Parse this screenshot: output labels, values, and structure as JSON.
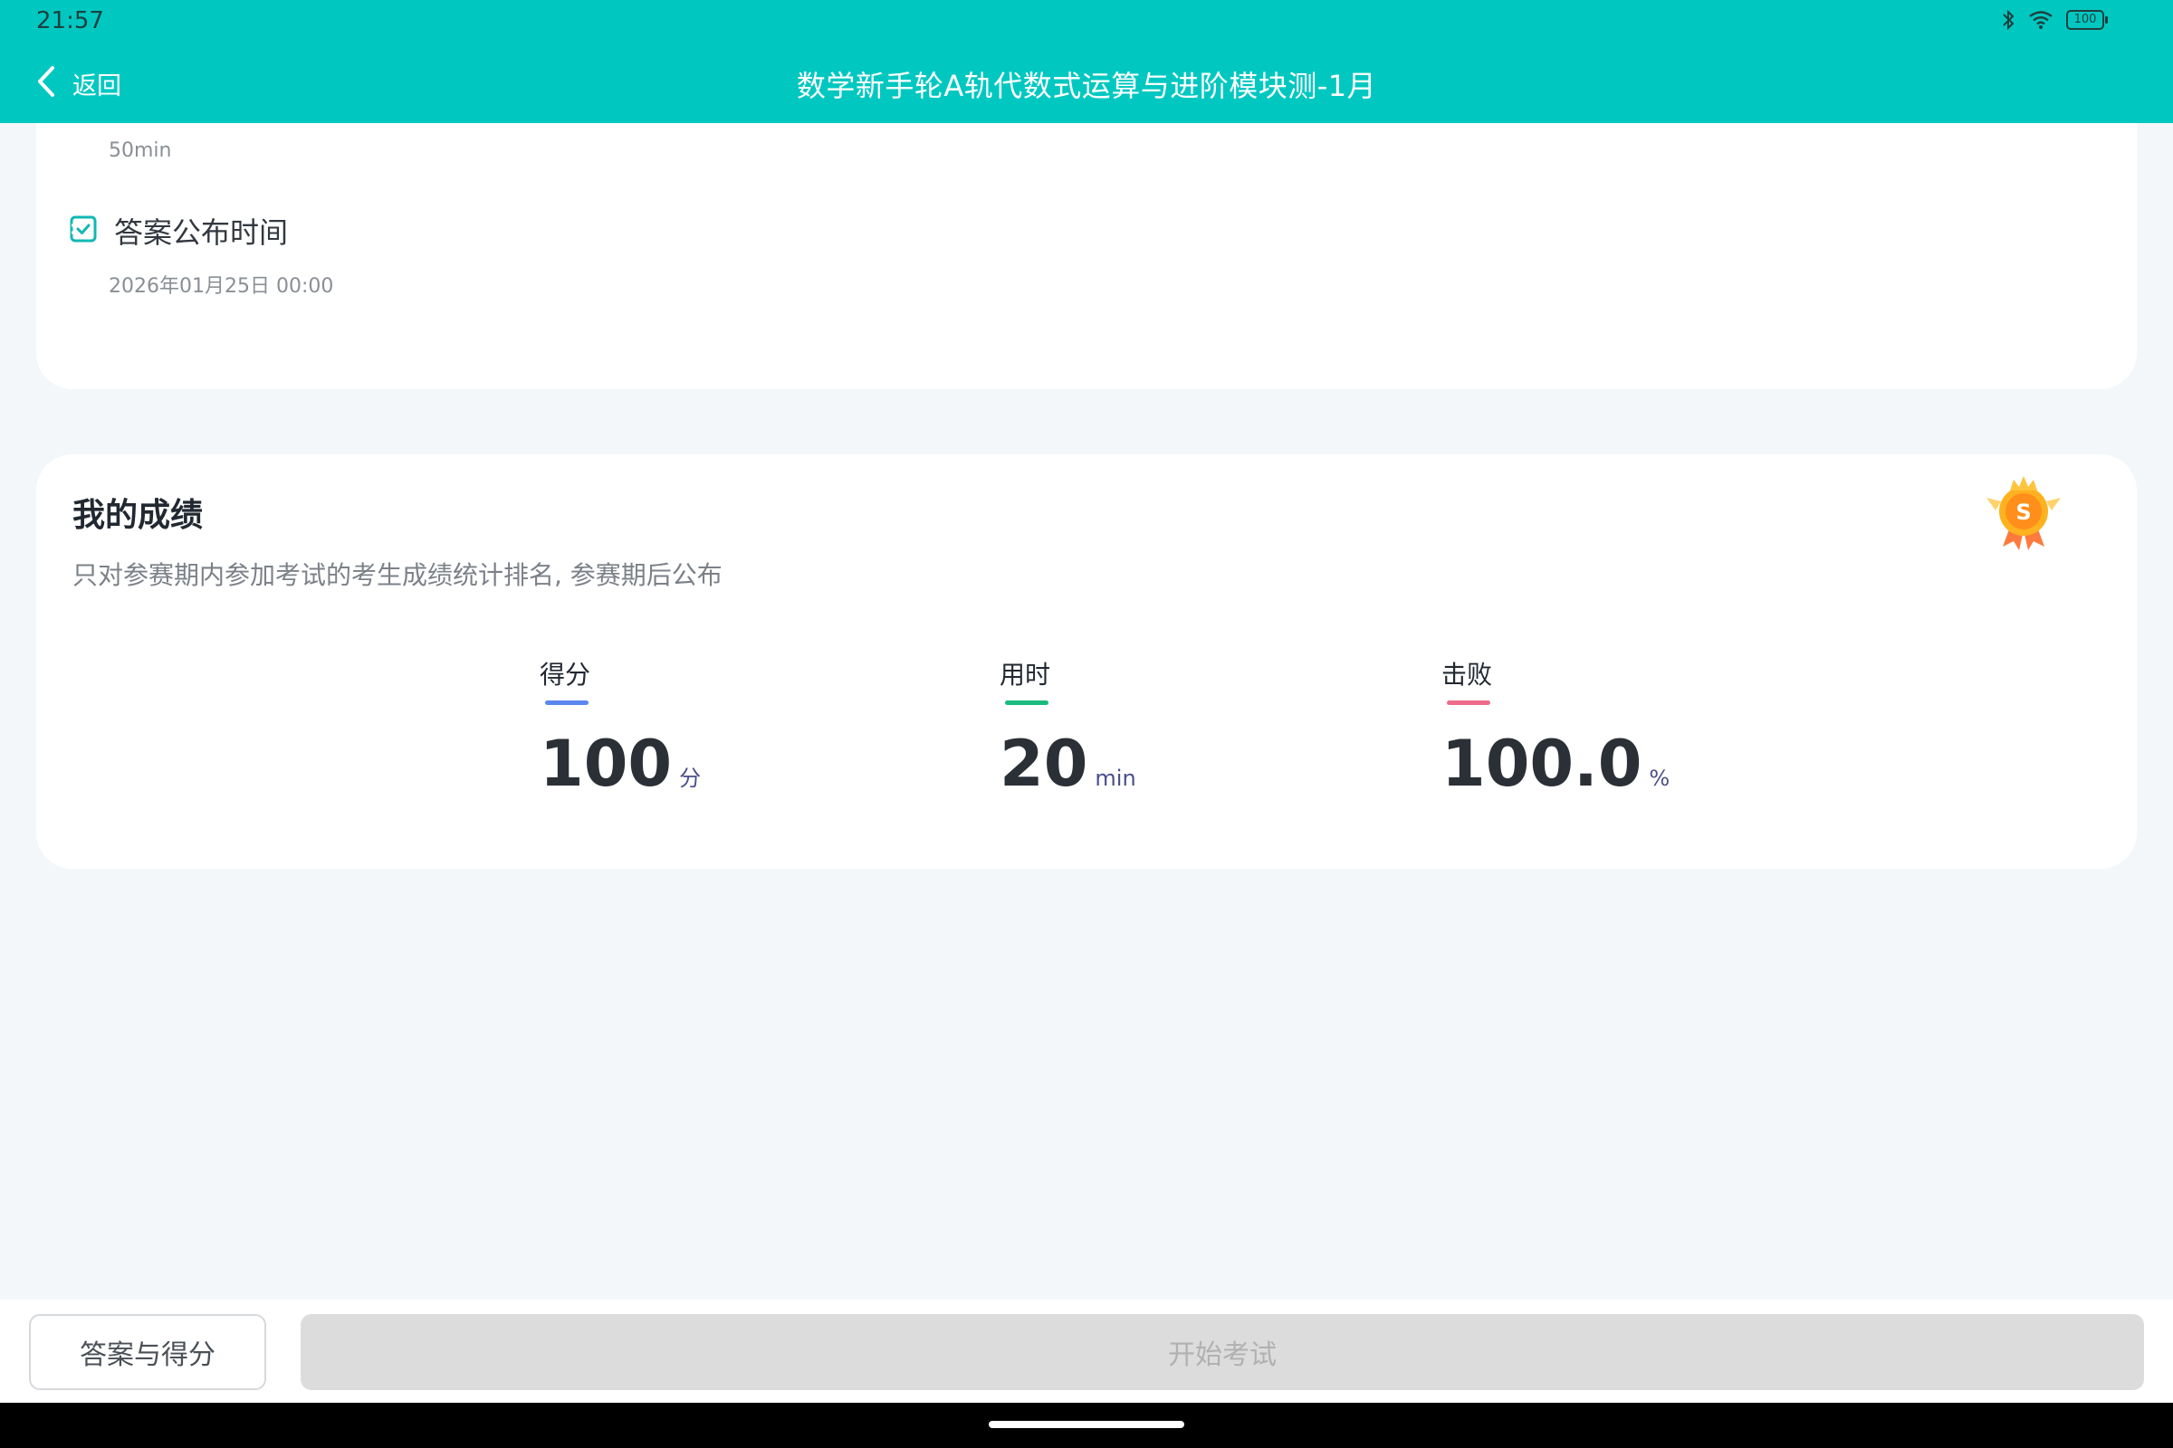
{
  "status_bar": {
    "time": "21:57",
    "battery": "100",
    "icons": [
      "bluetooth-icon",
      "wifi-icon",
      "battery-icon"
    ]
  },
  "nav": {
    "back_label": "返回",
    "title": "数学新手轮A轨代数式运算与进阶模块测-1月"
  },
  "exam_info": {
    "duration": "50min",
    "publish_label": "答案公布时间",
    "publish_date": "2026年01月25日 00:00"
  },
  "score_card": {
    "title": "我的成绩",
    "description": "只对参赛期内参加考试的考生成绩统计排名, 参赛期后公布",
    "medal_letter": "S",
    "metrics": [
      {
        "label": "得分",
        "value": "100",
        "unit": "分",
        "color": "#5b86f0"
      },
      {
        "label": "用时",
        "value": "20",
        "unit": "min",
        "color": "#19bb7e"
      },
      {
        "label": "击败",
        "value": "100.0",
        "unit": "%",
        "color": "#ee6b8a"
      }
    ]
  },
  "actions": {
    "answer_button": "答案与得分",
    "start_button": "开始考试"
  },
  "colors": {
    "primary": "#00c8c1",
    "background": "#f4f7f9",
    "disabled_button": "#dcdcdc"
  }
}
